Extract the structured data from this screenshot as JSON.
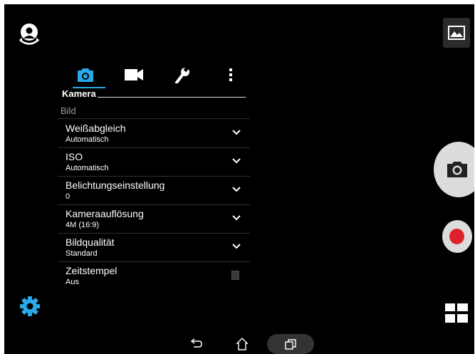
{
  "tabs": [
    {
      "label": "",
      "icon": "camera-icon"
    },
    {
      "label": "",
      "icon": "video-camera-icon"
    },
    {
      "label": "",
      "icon": "wrench-icon"
    },
    {
      "label": "",
      "icon": "more-vertical-icon"
    }
  ],
  "panel": {
    "section_title": "Kamera",
    "category": "Bild",
    "rows": [
      {
        "name": "Weißabgleich",
        "value": "Automatisch",
        "control": "dropdown"
      },
      {
        "name": "ISO",
        "value": "Automatisch",
        "control": "dropdown"
      },
      {
        "name": "Belichtungseinstellung",
        "value": "0",
        "control": "dropdown"
      },
      {
        "name": "Kameraauflösung",
        "value": "4M (16:9)",
        "control": "dropdown"
      },
      {
        "name": "Bildqualität",
        "value": "Standard",
        "control": "dropdown"
      },
      {
        "name": "Zeitstempel",
        "value": "Aus",
        "control": "checkbox",
        "checked": false
      }
    ]
  },
  "icons": {
    "switch_camera": "switch-camera-icon",
    "settings": "gear-icon",
    "gallery": "gallery-icon",
    "shutter": "camera-shutter-icon",
    "record": "record-icon",
    "modes": "grid-modes-icon",
    "back": "back-icon",
    "home": "home-icon",
    "recents": "recents-icon"
  },
  "colors": {
    "accent": "#29a9e8",
    "record": "#e0202b",
    "background": "#000000"
  }
}
